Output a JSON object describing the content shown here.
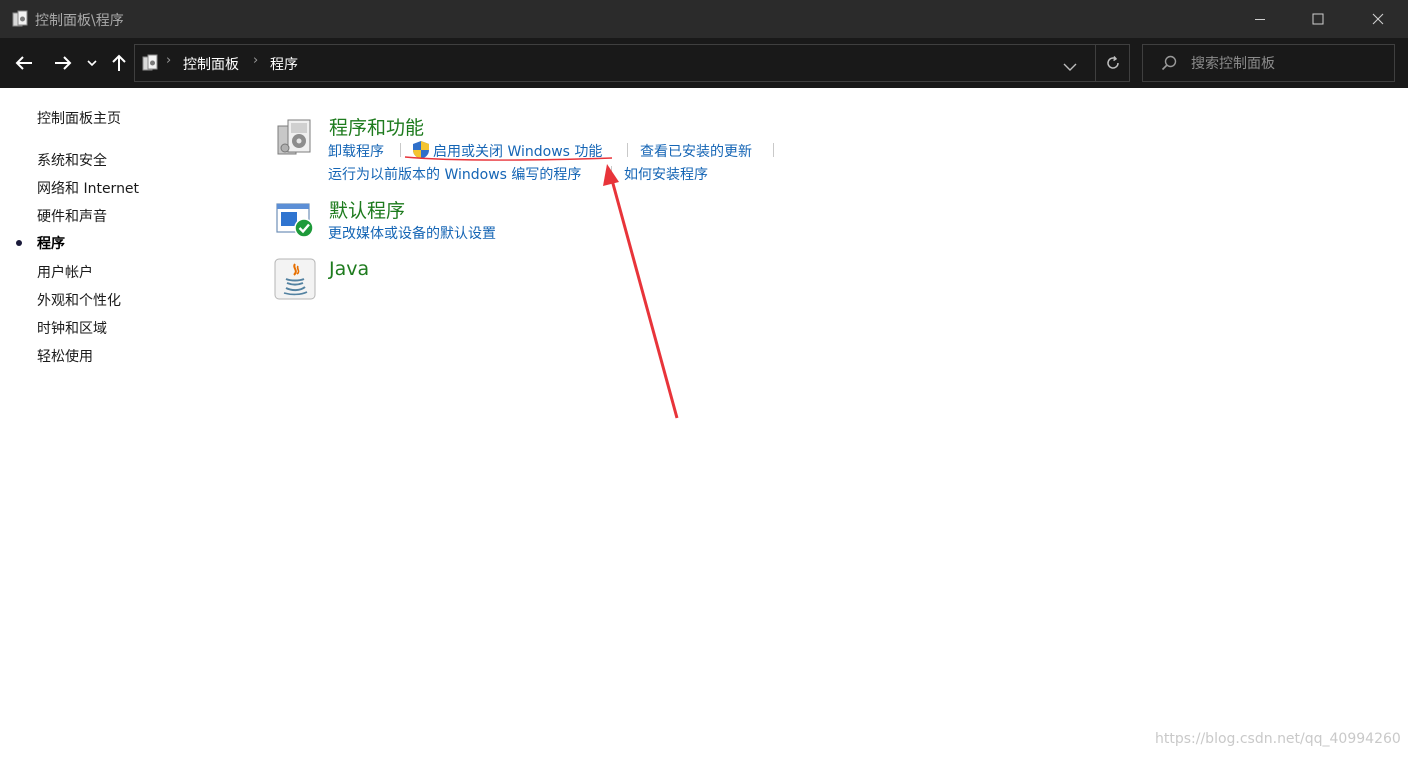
{
  "window": {
    "title": "控制面板\\程序"
  },
  "nav": {
    "breadcrumb": [
      "控制面板",
      "程序"
    ],
    "search_placeholder": "搜索控制面板"
  },
  "sidebar": {
    "home": "控制面板主页",
    "items": [
      {
        "label": "系统和安全",
        "active": false
      },
      {
        "label": "网络和 Internet",
        "active": false
      },
      {
        "label": "硬件和声音",
        "active": false
      },
      {
        "label": "程序",
        "active": true
      },
      {
        "label": "用户帐户",
        "active": false
      },
      {
        "label": "外观和个性化",
        "active": false
      },
      {
        "label": "时钟和区域",
        "active": false
      },
      {
        "label": "轻松使用",
        "active": false
      }
    ]
  },
  "main": {
    "programs_features": {
      "title": "程序和功能",
      "links": [
        "卸载程序",
        "启用或关闭 Windows 功能",
        "查看已安装的更新",
        "运行为以前版本的 Windows 编写的程序",
        "如何安装程序"
      ]
    },
    "default_programs": {
      "title": "默认程序",
      "links": [
        "更改媒体或设备的默认设置"
      ]
    },
    "java": {
      "title": "Java"
    }
  },
  "annotation": {
    "color": "#e8343a"
  },
  "watermark": "https://blog.csdn.net/qq_40994260"
}
